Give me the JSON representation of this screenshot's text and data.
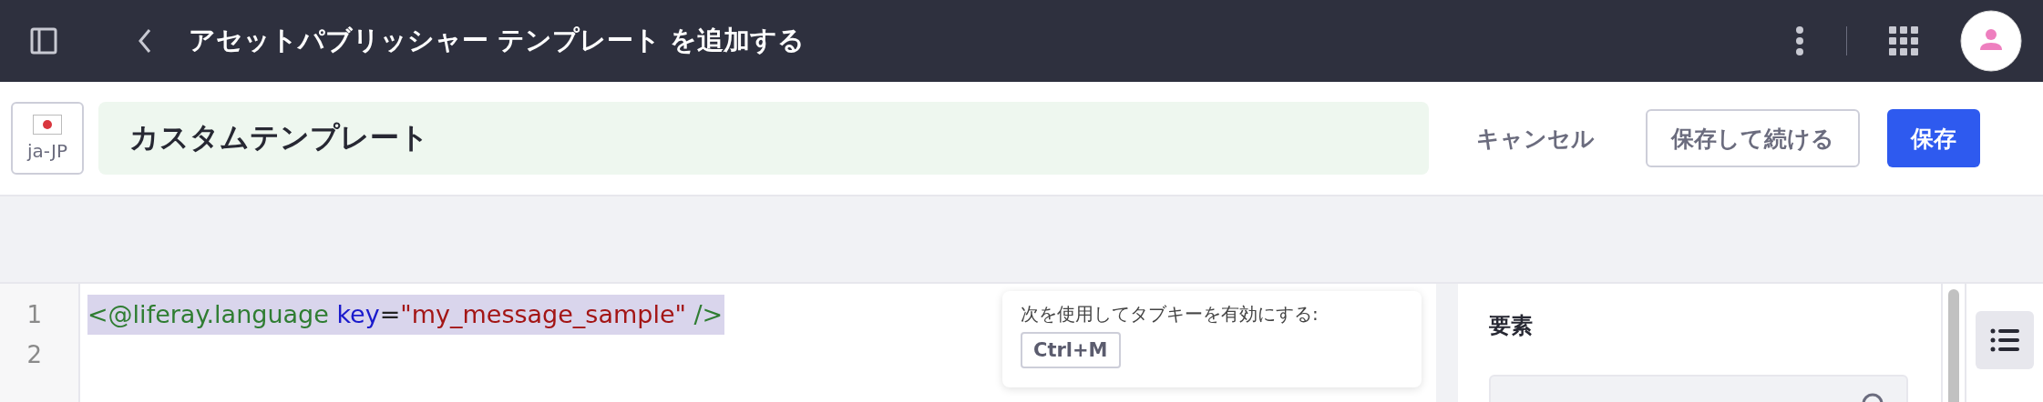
{
  "top_bar": {
    "title": "アセットパブリッシャー テンプレート を追加する"
  },
  "header": {
    "locale": "ja-JP",
    "name_field": {
      "value": "カスタムテンプレート"
    },
    "buttons": [
      {
        "label": "キャンセル",
        "kind": "link"
      },
      {
        "label": "保存して続ける",
        "kind": "secondary"
      },
      {
        "label": "保存",
        "kind": "primary"
      }
    ]
  },
  "editor": {
    "lines": [
      {
        "number": "1",
        "selected": true,
        "tokens": [
          {
            "text": "<@liferay.language",
            "color": "#2f7d32"
          },
          {
            "text": " key",
            "color": "#1a1acc"
          },
          {
            "text": "=",
            "color": "#222222"
          },
          {
            "text": "\"my_message_sample\"",
            "color": "#a31515"
          },
          {
            "text": " />",
            "color": "#2f7d32"
          }
        ]
      },
      {
        "number": "2",
        "selected": false
      }
    ]
  },
  "tooltip": {
    "text": "次を使用してタブキーを有効にする:",
    "key": "Ctrl+M"
  },
  "sidebar": {
    "title": "要素"
  }
}
